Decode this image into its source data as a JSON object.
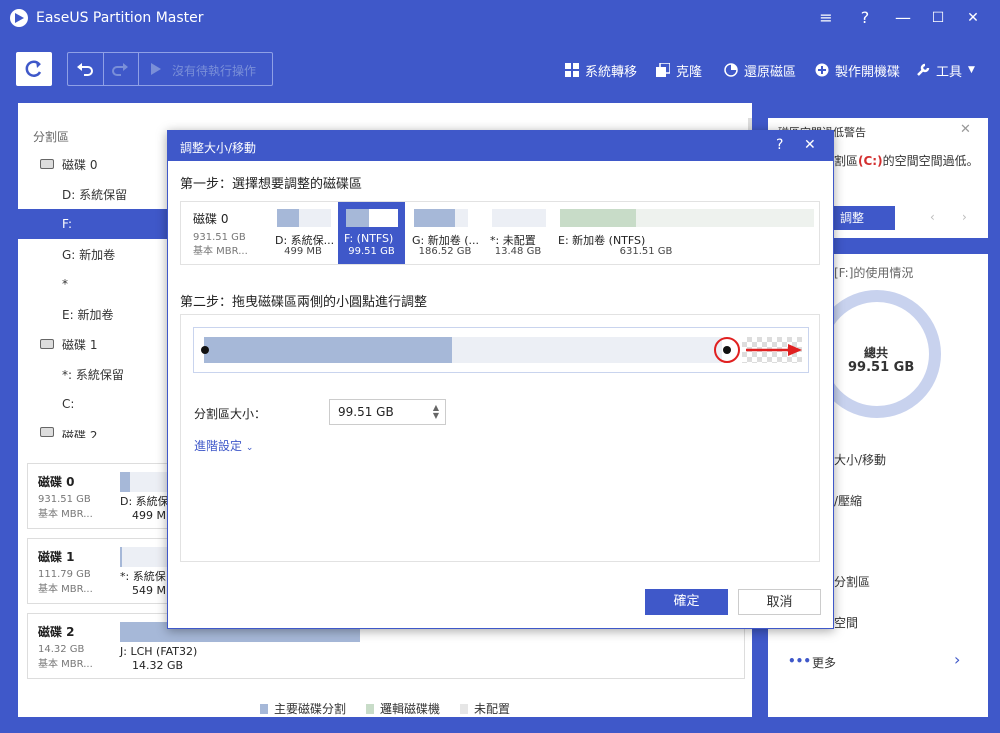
{
  "app": {
    "title": "EaseUS Partition Master"
  },
  "window_controls": {
    "menu": "≡",
    "help": "?",
    "minimize": "—",
    "maximize": "☐",
    "close": "✕"
  },
  "toolbar": {
    "pending_label": "沒有待執行操作",
    "actions": [
      {
        "label": "系統轉移",
        "icon": "windows-icon"
      },
      {
        "label": "克隆",
        "icon": "clone-icon"
      },
      {
        "label": "還原磁區",
        "icon": "restore-icon"
      },
      {
        "label": "製作開機碟",
        "icon": "boot-media-icon"
      },
      {
        "label": "工具",
        "icon": "wrench-icon"
      }
    ]
  },
  "partition_list": {
    "header": "分割區",
    "rows": [
      {
        "label": "磁碟 0",
        "type": "disk"
      },
      {
        "label": "D: 系統保留",
        "type": "part"
      },
      {
        "label": "F:",
        "type": "part",
        "selected": true
      },
      {
        "label": "G: 新加卷",
        "type": "part"
      },
      {
        "label": "*",
        "type": "part"
      },
      {
        "label": "E: 新加卷",
        "type": "part"
      },
      {
        "label": "磁碟 1",
        "type": "disk"
      },
      {
        "label": "*: 系統保留",
        "type": "part"
      },
      {
        "label": "C:",
        "type": "part"
      },
      {
        "label": "磁碟 2",
        "type": "disk"
      }
    ]
  },
  "disk_cards": [
    {
      "name": "磁碟 0",
      "size": "931.51 GB",
      "kind": "基本 MBR...",
      "part_name": "D: 系統保",
      "part_size": "499 MB",
      "fill": 0.2
    },
    {
      "name": "磁碟 1",
      "size": "111.79 GB",
      "kind": "基本 MBR...",
      "part_name": "*: 系統保",
      "part_size": "549 MB",
      "fill": 0.04
    },
    {
      "name": "磁碟 2",
      "size": "14.32 GB",
      "kind": "基本 MBR...",
      "part_name": "J: LCH (FAT32)",
      "part_size": "14.32 GB",
      "fill": 1.0
    }
  ],
  "legend": [
    {
      "label": "主要磁碟分割",
      "color": "#a6b8d8"
    },
    {
      "label": "邏輯磁碟機",
      "color": "#c8dcc8"
    },
    {
      "label": "未配置",
      "color": "#e6e6e6"
    }
  ],
  "right_panel": {
    "warning_title": "磁區空間過低警告",
    "warning_text_prefix": "割區",
    "warning_drive": "(C:)",
    "warning_text_suffix": "的空間空間過低。",
    "adjust_button": "調整",
    "usage_title": "[F:]的使用情況",
    "total_label": "總共",
    "total_value": "99.51 GB",
    "menu": [
      "大小/移動",
      "/壓縮",
      "分割區",
      "空間"
    ],
    "more": "更多"
  },
  "dialog": {
    "title": "調整大小/移動",
    "help": "?",
    "close": "✕",
    "step1": "第一步：選擇想要調整的磁碟區",
    "disk": {
      "name": "磁碟 0",
      "size": "931.51 GB",
      "kind": "基本 MBR..."
    },
    "partitions": [
      {
        "name": "D: 系統保...",
        "size": "499 MB",
        "fill": 0.4
      },
      {
        "name": "F: (NTFS)",
        "size": "99.51 GB",
        "fill": 0.45,
        "selected": true
      },
      {
        "name": "G: 新加卷 (...",
        "size": "186.52 GB",
        "fill": 0.75
      },
      {
        "name": "*: 未配置",
        "size": "13.48 GB",
        "fill": 0
      },
      {
        "name": "E: 新加卷 (NTFS)",
        "size": "631.51 GB",
        "fill": 0.3
      }
    ],
    "step2": "第二步：拖曳磁碟區兩側的小圓點進行調整",
    "size_label": "分割區大小：",
    "size_value": "99.51 GB",
    "advanced": "進階設定",
    "ok": "確定",
    "cancel": "取消"
  }
}
